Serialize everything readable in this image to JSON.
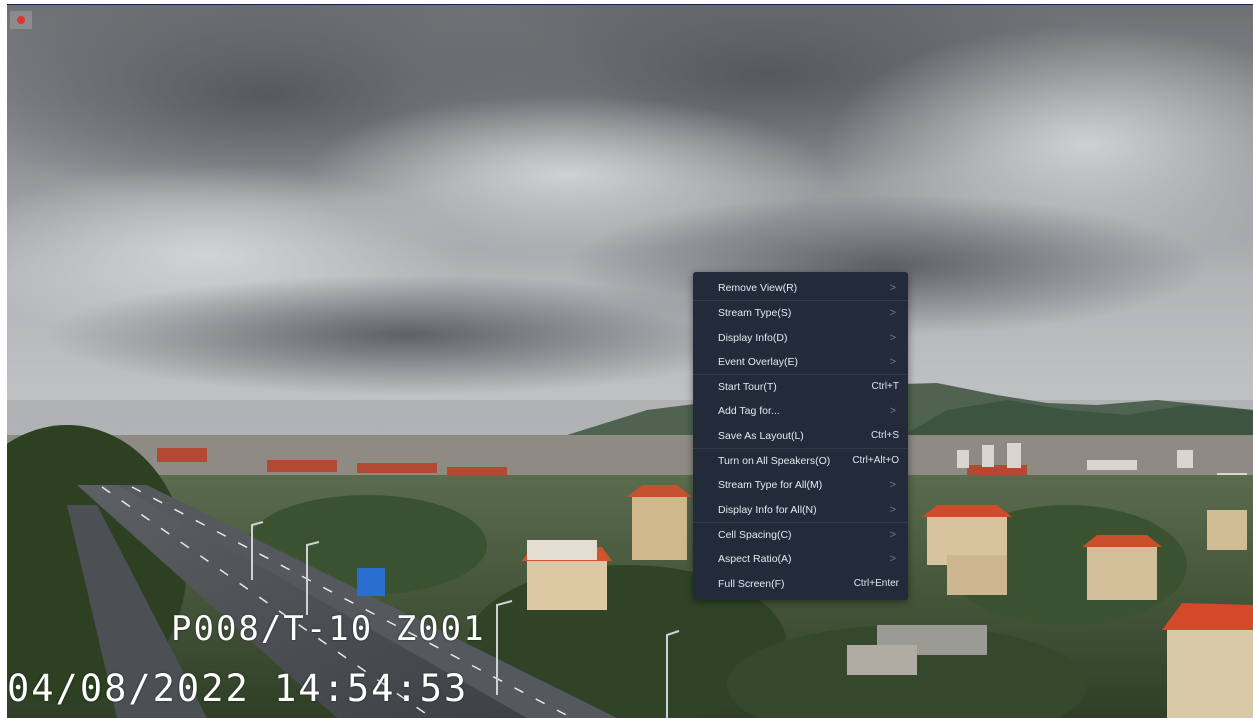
{
  "video": {
    "camera_label": "P008/T-10  Z001",
    "datetime": "04/08/2022  14:54:53"
  },
  "indicator": {
    "icon": "record-dot-icon",
    "color": "#e0322e"
  },
  "context_menu": {
    "groups": [
      {
        "items": [
          {
            "label": "Remove View(R)",
            "shortcut": "",
            "submenu": true
          }
        ]
      },
      {
        "items": [
          {
            "label": "Stream Type(S)",
            "shortcut": "",
            "submenu": true
          },
          {
            "label": "Display Info(D)",
            "shortcut": "",
            "submenu": true
          },
          {
            "label": "Event Overlay(E)",
            "shortcut": "",
            "submenu": true
          }
        ]
      },
      {
        "items": [
          {
            "label": "Start Tour(T)",
            "shortcut": "Ctrl+T",
            "submenu": false
          },
          {
            "label": "Add Tag for...",
            "shortcut": "",
            "submenu": true
          },
          {
            "label": "Save As Layout(L)",
            "shortcut": "Ctrl+S",
            "submenu": false
          }
        ]
      },
      {
        "items": [
          {
            "label": "Turn on All Speakers(O)",
            "shortcut": "Ctrl+Alt+O",
            "submenu": false
          },
          {
            "label": "Stream Type for All(M)",
            "shortcut": "",
            "submenu": true
          },
          {
            "label": "Display Info for All(N)",
            "shortcut": "",
            "submenu": true
          }
        ]
      },
      {
        "items": [
          {
            "label": "Cell Spacing(C)",
            "shortcut": "",
            "submenu": true
          },
          {
            "label": "Aspect Ratio(A)",
            "shortcut": "",
            "submenu": true
          },
          {
            "label": "Full Screen(F)",
            "shortcut": "Ctrl+Enter",
            "submenu": false
          }
        ]
      }
    ],
    "arrow_glyph": ">"
  },
  "colors": {
    "menu_bg": "#232b3a",
    "menu_text": "#e4e8ee",
    "menu_divider": "#313a4b",
    "osd_text": "#ffffff"
  }
}
